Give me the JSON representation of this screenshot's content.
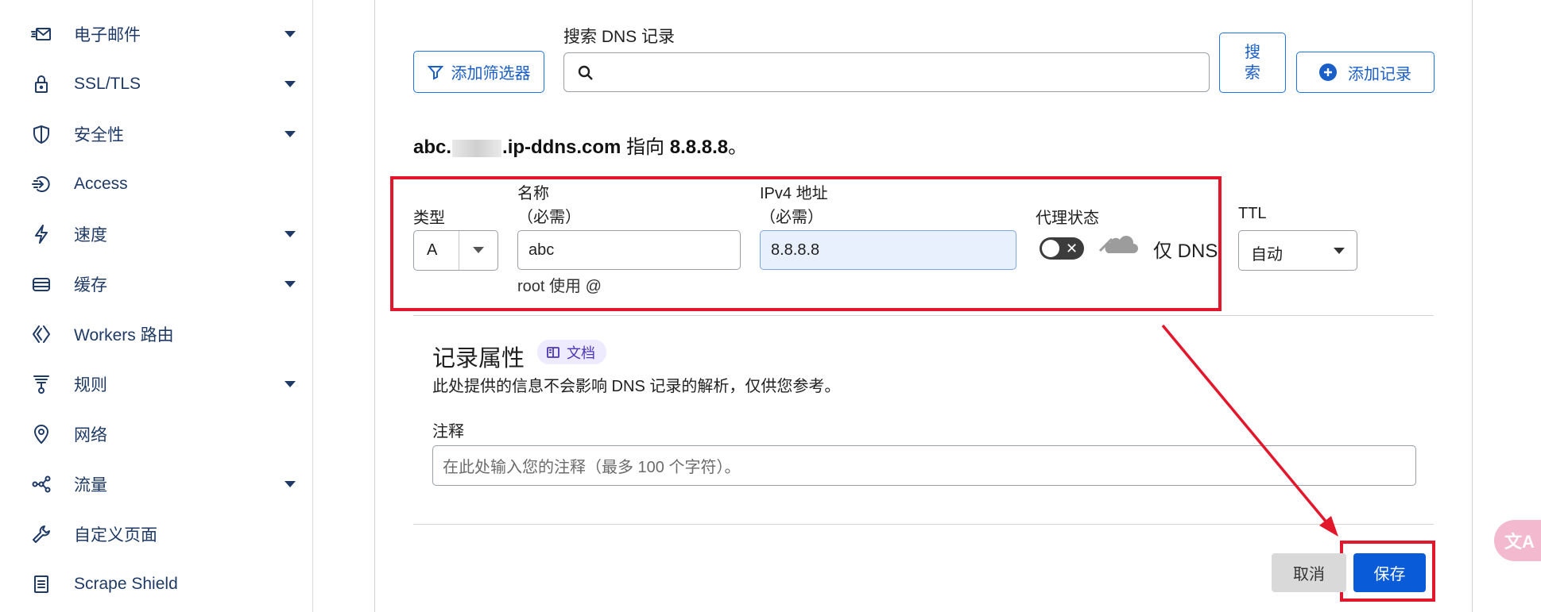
{
  "sidebar": {
    "items": [
      {
        "label": "电子邮件",
        "icon": "email-icon",
        "has_caret": true
      },
      {
        "label": "SSL/TLS",
        "icon": "lock-icon",
        "has_caret": true
      },
      {
        "label": "安全性",
        "icon": "shield-icon",
        "has_caret": true
      },
      {
        "label": "Access",
        "icon": "access-icon",
        "has_caret": false
      },
      {
        "label": "速度",
        "icon": "lightning-icon",
        "has_caret": true
      },
      {
        "label": "缓存",
        "icon": "cache-drive-icon",
        "has_caret": true
      },
      {
        "label": "Workers 路由",
        "icon": "workers-icon",
        "has_caret": false
      },
      {
        "label": "规则",
        "icon": "rules-funnel-icon",
        "has_caret": true
      },
      {
        "label": "网络",
        "icon": "location-pin-icon",
        "has_caret": false
      },
      {
        "label": "流量",
        "icon": "traffic-icon",
        "has_caret": true
      },
      {
        "label": "自定义页面",
        "icon": "wrench-icon",
        "has_caret": false
      },
      {
        "label": "Scrape Shield",
        "icon": "document-icon",
        "has_caret": false
      }
    ]
  },
  "toolbar": {
    "add_filter_label": "添加筛选器",
    "search_label": "搜索 DNS 记录",
    "search_value": "",
    "search_button_label": "搜\n索",
    "add_record_label": "添加记录"
  },
  "record_summary": {
    "host_prefix": "abc.",
    "host_suffix": ".ip-ddns.com",
    "points_to_text": "指向",
    "target": "8.8.8.8",
    "end_punct": "。"
  },
  "form": {
    "type_label": "类型",
    "type_value": "A",
    "name_label": "名称",
    "name_required": "（必需）",
    "name_value": "abc",
    "name_hint": "root 使用 @",
    "ipv4_label": "IPv4 地址",
    "ipv4_required": "（必需）",
    "ipv4_value": "8.8.8.8",
    "proxy_label": "代理状态",
    "proxy_toggle_symbol": "✕",
    "proxy_text": "仅 DNS",
    "ttl_label": "TTL",
    "ttl_value": "自动"
  },
  "attributes": {
    "title": "记录属性",
    "doc_badge": "文档",
    "description": "此处提供的信息不会影响 DNS 记录的解析，仅供您参考。",
    "note_label": "注释",
    "note_placeholder": "在此处输入您的注释（最多 100 个字符）。"
  },
  "actions": {
    "cancel_label": "取消",
    "save_label": "保存"
  },
  "translate_fab": {
    "label": "文A"
  },
  "colors": {
    "accent": "#1a73e8",
    "annotation_red": "#e3172b",
    "save_bg": "#0a5bd8",
    "nav_text": "#1f3a66"
  }
}
